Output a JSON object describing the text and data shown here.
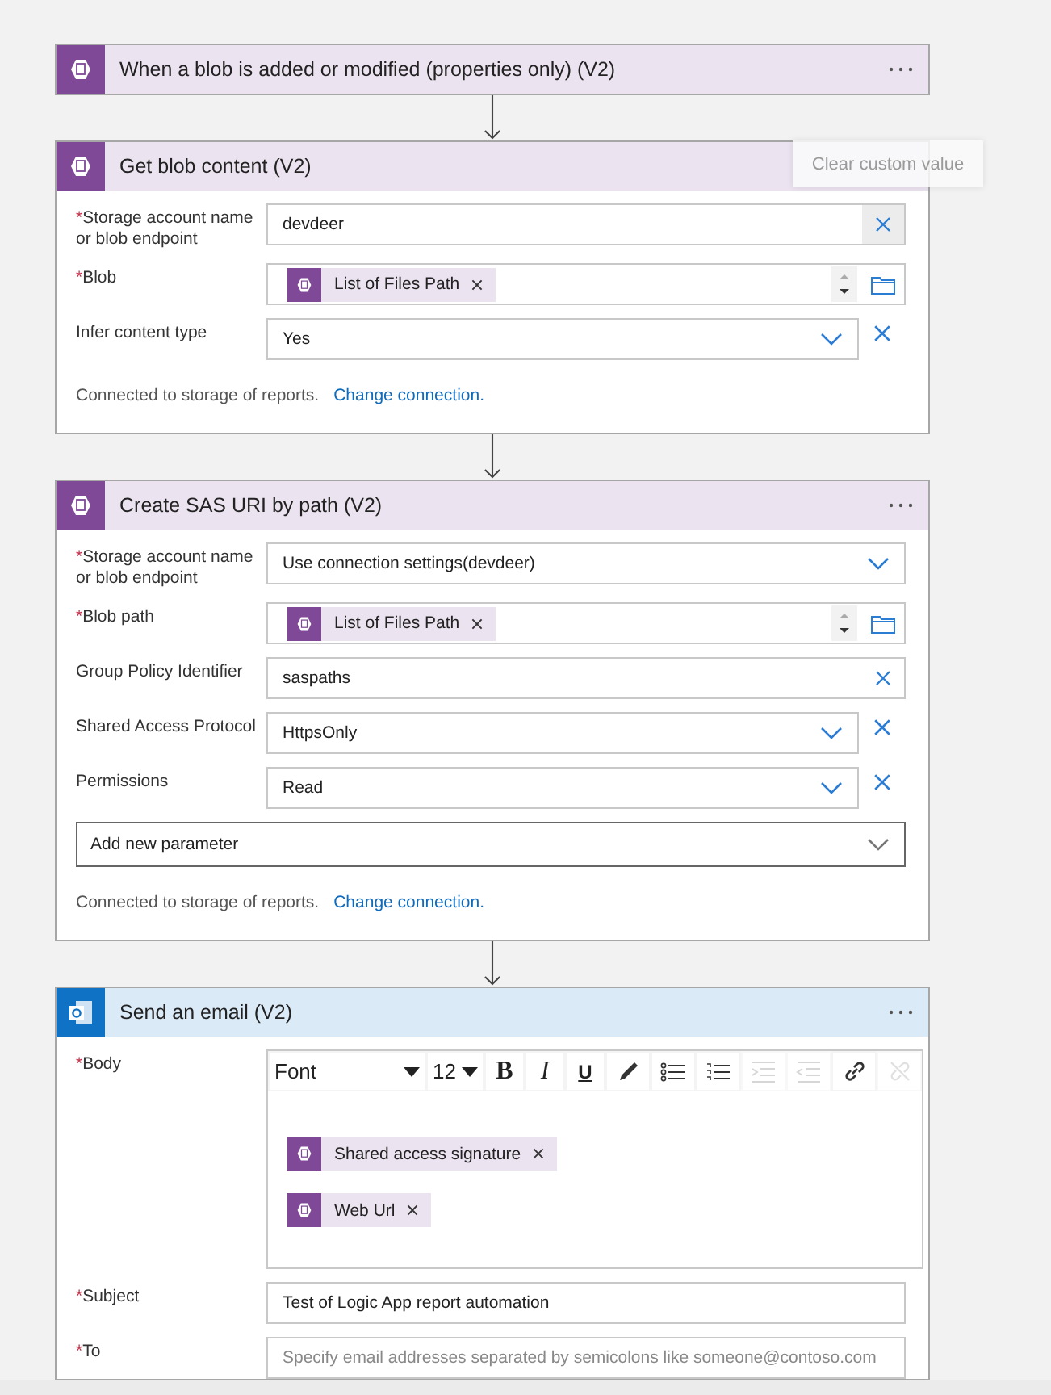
{
  "cards": [
    {
      "kind": "blob",
      "title": "When a blob is added or modified (properties only) (V2)"
    },
    {
      "kind": "blob",
      "title": "Get blob content (V2)",
      "tooltip": "Clear custom value",
      "fields": [
        {
          "kind": "text",
          "label": "Storage account name or blob endpoint",
          "marker": "*",
          "value": "devdeer",
          "hovered": true
        },
        {
          "kind": "token",
          "label": "Blob",
          "marker": "*",
          "tokens": [
            "List of Files Path"
          ]
        },
        {
          "kind": "dropdown-clear",
          "label": "Infer content type",
          "value": "Yes"
        }
      ],
      "footer": {
        "text": "Connected to storage of reports.",
        "link": "Change connection."
      }
    },
    {
      "kind": "blob",
      "title": "Create SAS URI by path (V2)",
      "fields": [
        {
          "kind": "dropdown",
          "label": "Storage account name or blob endpoint",
          "marker": "*",
          "value": "Use connection settings(devdeer)"
        },
        {
          "kind": "token",
          "label": "Blob path",
          "marker": "*",
          "tokens": [
            "List of Files Path"
          ]
        },
        {
          "kind": "text",
          "label": "Group Policy Identifier",
          "value": "saspaths",
          "hovered": false
        },
        {
          "kind": "dropdown-clear",
          "label": "Shared Access Protocol",
          "value": "HttpsOnly"
        },
        {
          "kind": "dropdown-clear",
          "label": "Permissions",
          "value": "Read"
        },
        {
          "kind": "picker",
          "value": "Add new parameter"
        }
      ],
      "footer": {
        "text": "Connected to storage of reports.",
        "link": "Change connection."
      }
    },
    {
      "kind": "email",
      "title": "Send an email (V2)",
      "fields": [
        {
          "kind": "editor",
          "label": "Body",
          "marker": "*",
          "toolbar": [
            {
              "kind": "select",
              "label": "Font",
              "disabled": false
            },
            {
              "kind": "select",
              "label": "12",
              "disabled": false
            },
            {
              "kind": "bold",
              "label": "B",
              "disabled": false
            },
            {
              "kind": "italic",
              "label": "I",
              "disabled": false
            },
            {
              "kind": "underline",
              "label": "U",
              "disabled": false
            },
            {
              "kind": "color",
              "disabled": false
            },
            {
              "kind": "bullets",
              "disabled": false
            },
            {
              "kind": "numbers",
              "disabled": false
            },
            {
              "kind": "indent",
              "disabled": true
            },
            {
              "kind": "outdent",
              "disabled": true
            },
            {
              "kind": "link",
              "disabled": false
            },
            {
              "kind": "unlink",
              "disabled": true
            }
          ],
          "tokens": [
            "Shared access signature",
            "Web Url"
          ]
        },
        {
          "kind": "plain",
          "label": "Subject",
          "marker": "*",
          "value": "Test of Logic App report automation"
        },
        {
          "kind": "placeholder",
          "label": "To",
          "marker": "*",
          "placeholder": "Specify email addresses separated by semicolons like someone@contoso.com"
        }
      ]
    }
  ]
}
